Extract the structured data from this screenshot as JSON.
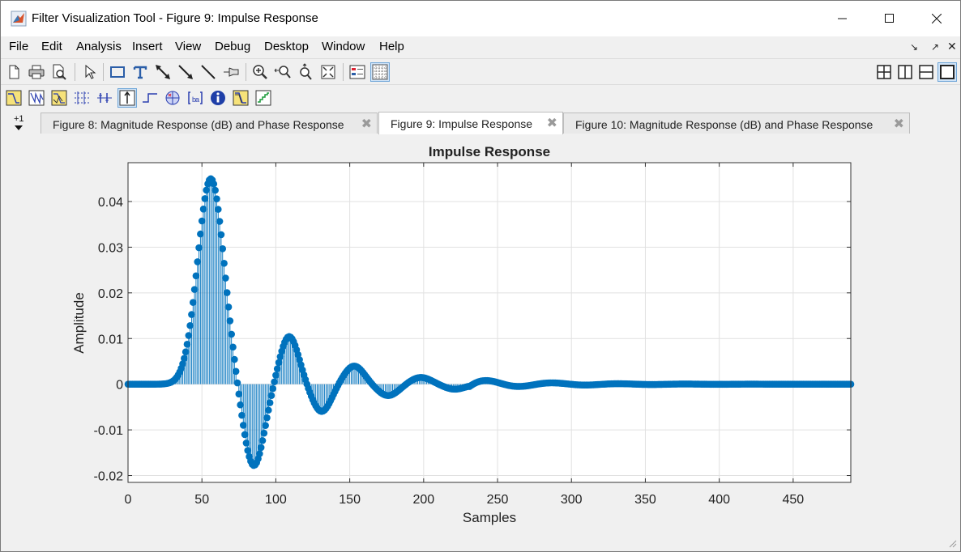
{
  "window": {
    "title": "Filter Visualization Tool - Figure 9: Impulse Response",
    "minimize_icon": "minimize-icon",
    "maximize_icon": "maximize-icon",
    "close_icon": "close-icon"
  },
  "menubar": {
    "items": [
      "File",
      "Edit",
      "Analysis",
      "Insert",
      "View",
      "Debug",
      "Desktop",
      "Window",
      "Help"
    ]
  },
  "toolbar1": {
    "icons": [
      "new-figure-icon",
      "print-icon",
      "print-preview-icon",
      "pointer-icon",
      "rectangle-icon",
      "text-icon",
      "double-arrow-icon",
      "arrow-icon",
      "line-icon",
      "pin-icon",
      "zoom-in-icon",
      "zoom-x-icon",
      "zoom-y-icon",
      "full-view-icon",
      "legend-icon",
      "grid-icon"
    ],
    "layout_icons": [
      "tile-grid-icon",
      "tile-vertical-icon",
      "tile-horizontal-icon",
      "single-view-icon"
    ]
  },
  "toolbar2": {
    "icons": [
      "magnitude-response-icon",
      "phase-response-icon",
      "magnitude-phase-icon",
      "group-delay-icon",
      "phase-delay-icon",
      "impulse-response-icon",
      "step-response-icon",
      "pole-zero-icon",
      "coefficients-icon",
      "filter-info-icon",
      "magnitude-estimate-icon",
      "noise-power-icon"
    ]
  },
  "tabs": {
    "new_tab_label": "+1",
    "items": [
      {
        "label": "Figure 8: Magnitude Response (dB) and Phase Response",
        "active": false
      },
      {
        "label": "Figure 9: Impulse Response",
        "active": true
      },
      {
        "label": "Figure 10: Magnitude Response (dB) and Phase Response",
        "active": false
      }
    ]
  },
  "colors": {
    "stem": "#0072bd",
    "grid": "#e1e1e1",
    "axes_bg": "#ffffff"
  },
  "chart_data": {
    "type": "stem",
    "title": "Impulse Response",
    "xlabel": "Samples",
    "ylabel": "Amplitude",
    "xlim": [
      0,
      489
    ],
    "ylim": [
      -0.0215,
      0.0485
    ],
    "xticks": [
      0,
      50,
      100,
      150,
      200,
      250,
      300,
      350,
      400,
      450
    ],
    "yticks": [
      -0.02,
      -0.01,
      0,
      0.01,
      0.02,
      0.03,
      0.04
    ],
    "ytick_labels": [
      "-0.02",
      "-0.01",
      "0",
      "0.01",
      "0.02",
      "0.03",
      "0.04"
    ],
    "grid": true,
    "num_samples": 490,
    "key_points": [
      {
        "x": 56,
        "y": 0.045
      },
      {
        "x": 85,
        "y": -0.018
      },
      {
        "x": 109,
        "y": 0.0105
      },
      {
        "x": 131,
        "y": -0.006
      },
      {
        "x": 153,
        "y": 0.004
      },
      {
        "x": 176,
        "y": -0.0025
      },
      {
        "x": 198,
        "y": 0.0015
      },
      {
        "x": 221,
        "y": -0.0011
      },
      {
        "x": 243,
        "y": 0.0008
      },
      {
        "x": 288,
        "y": 0.0004
      }
    ]
  }
}
